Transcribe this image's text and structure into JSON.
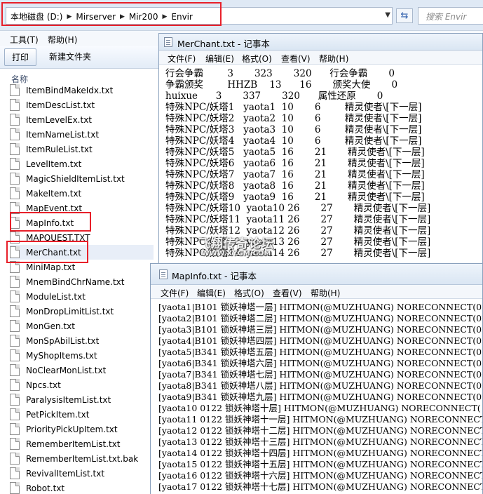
{
  "explorer": {
    "breadcrumb": [
      "本地磁盘 (D:)",
      "Mirserver",
      "Mir200",
      "Envir"
    ],
    "search_placeholder": "搜索 Envir",
    "menu": [
      "工具(T)",
      "帮助(H)"
    ],
    "toolbar": {
      "print_label": "打印",
      "new_folder_label": "新建文件夹"
    },
    "column_name": "名称",
    "files": [
      "ItemBindMakeIdx.txt",
      "ItemDescList.txt",
      "ItemLevelEx.txt",
      "ItemNameList.txt",
      "ItemRuleList.txt",
      "LevelItem.txt",
      "MagicShieldItemList.txt",
      "MakeItem.txt",
      "MapEvent.txt",
      "MapInfo.txt",
      "MAPQUEST.TXT",
      "MerChant.txt",
      "MiniMap.txt",
      "MnemBindChrName.txt",
      "ModuleList.txt",
      "MonDropLimitList.txt",
      "MonGen.txt",
      "MonSpAbilList.txt",
      "MyShopItems.txt",
      "NoClearMonList.txt",
      "Npcs.txt",
      "ParalysisItemList.txt",
      "PetPickItem.txt",
      "PriorityPickUpItem.txt",
      "RememberItemList.txt",
      "RememberItemList.txt.bak",
      "RevivalItemList.txt",
      "Robot.txt"
    ],
    "selected_file": "MerChant.txt",
    "highlight_color": "#e8202a"
  },
  "notepad1": {
    "title": "MerChant.txt - 记事本",
    "menu": [
      "文件(F)",
      "编辑(E)",
      "格式(O)",
      "查看(V)",
      "帮助(H)"
    ],
    "lines": [
      "行会争霸        3       323       320      行会争霸       0",
      "争霸颁奖        HHZB    13      16       颁奖大使       0",
      "huixue      3       337       320      属性还原       0",
      "特殊NPC/妖塔1   yaota1  10       6        精灵使者\\[下一层]",
      "特殊NPC/妖塔2   yaota2  10       6        精灵使者\\[下一层]",
      "特殊NPC/妖塔3   yaota3  10       6        精灵使者\\[下一层]",
      "特殊NPC/妖塔4   yaota4  10       6        精灵使者\\[下一层]",
      "特殊NPC/妖塔5   yaota5  16       21       精灵使者\\[下一层]",
      "特殊NPC/妖塔6   yaota6  16       21       精灵使者\\[下一层]",
      "特殊NPC/妖塔7   yaota7  16       21       精灵使者\\[下一层]",
      "特殊NPC/妖塔8   yaota8  16       21       精灵使者\\[下一层]",
      "特殊NPC/妖塔9   yaota9  16       21       精灵使者\\[下一层]",
      "特殊NPC/妖塔10  yaota10 26       27       精灵使者\\[下一层]",
      "特殊NPC/妖塔11  yaota11 26       27       精灵使者\\[下一层]",
      "特殊NPC/妖塔12  yaota12 26       27       精灵使者\\[下一层]",
      "特殊NPC/妖塔13  yaota13 26       27       精灵使者\\[下一层]",
      "特殊NPC/妖塔14  yaota14 26       27       精灵使者\\[下一层]"
    ]
  },
  "notepad2": {
    "title": "MapInfo.txt - 记事本",
    "menu": [
      "文件(F)",
      "编辑(E)",
      "格式(O)",
      "查看(V)",
      "帮助(H)"
    ],
    "lines": [
      "[yaota1|B101 锁妖神塔一层] HITMON(@MUZHUANG) NORECONNECT(0",
      "[yaota2|B101 锁妖神塔二层] HITMON(@MUZHUANG) NORECONNECT(0",
      "[yaota3|B101 锁妖神塔三层] HITMON(@MUZHUANG) NORECONNECT(0",
      "[yaota4|B101 锁妖神塔四层] HITMON(@MUZHUANG) NORECONNECT(0",
      "[yaota5|B341 锁妖神塔五层] HITMON(@MUZHUANG) NORECONNECT(0",
      "[yaota6|B341 锁妖神塔六层] HITMON(@MUZHUANG) NORECONNECT(0",
      "[yaota7|B341 锁妖神塔七层] HITMON(@MUZHUANG) NORECONNECT(0",
      "[yaota8|B341 锁妖神塔八层] HITMON(@MUZHUANG) NORECONNECT(0",
      "[yaota9|B341 锁妖神塔九层] HITMON(@MUZHUANG) NORECONNECT(0",
      "[yaota10 0122 锁妖神塔十层] HITMON(@MUZHUANG) NORECONNECT(",
      "[yaota11 0122 锁妖神塔十一层] HITMON(@MUZHUANG) NORECONNECT",
      "[yaota12 0122 锁妖神塔十二层] HITMON(@MUZHUANG) NORECONNECT",
      "[yaota13 0122 锁妖神塔十三层] HITMON(@MUZHUANG) NORECONNECT",
      "[yaota14 0122 锁妖神塔十四层] HITMON(@MUZHUANG) NORECONNECT",
      "[yaota15 0122 锁妖神塔十五层] HITMON(@MUZHUANG) NORECONNECT",
      "[yaota16 0122 锁妖神塔十六层] HITMON(@MUZHUANG) NORECONNECT",
      "[yaota17 0122 锁妖神塔十七层] HITMON(@MUZHUANG) NORECONNECT"
    ]
  },
  "watermark": {
    "line1": "飞翔传奇论坛",
    "line2": "WWW.XYGM.COM"
  }
}
